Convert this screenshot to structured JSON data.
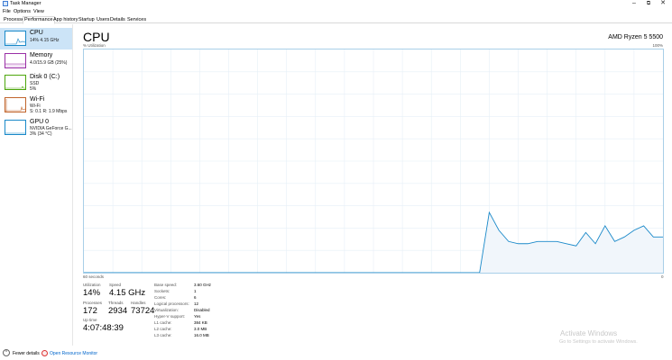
{
  "window": {
    "title": "Task Manager",
    "minimize": "–",
    "maximize": "⧉",
    "close": "✕"
  },
  "menu": [
    "File",
    "Options",
    "View"
  ],
  "tabs": [
    "Processes",
    "Performance",
    "App history",
    "Startup",
    "Users",
    "Details",
    "Services"
  ],
  "active_tab": "Performance",
  "sidebar": {
    "items": [
      {
        "name": "CPU",
        "lines": [
          "14%  4.15 GHz"
        ],
        "color": "#1a89c9",
        "selected": true
      },
      {
        "name": "Memory",
        "lines": [
          "4.0/15.9 GB (25%)"
        ],
        "color": "#9a2fa6",
        "selected": false
      },
      {
        "name": "Disk 0 (C:)",
        "lines": [
          "SSD",
          "5%"
        ],
        "color": "#4da60c",
        "selected": false
      },
      {
        "name": "Wi-Fi",
        "lines": [
          "Wi-Fi",
          "S: 0.1  R: 1.9 Mbps"
        ],
        "color": "#c1642b",
        "selected": false
      },
      {
        "name": "GPU 0",
        "lines": [
          "NVIDIA GeForce G...",
          "3%  (34 °C)"
        ],
        "color": "#1a89c9",
        "selected": false
      }
    ]
  },
  "main": {
    "title": "CPU",
    "model": "AMD Ryzen 5 5500",
    "util_label": "% Utilization",
    "util_max": "100%",
    "axis_left": "60 seconds",
    "axis_right": "0"
  },
  "chart_data": {
    "type": "area",
    "ylim": [
      0,
      100
    ],
    "xlim": [
      60,
      0
    ],
    "grid": true,
    "x": [
      60,
      19,
      18,
      17,
      16,
      15,
      14,
      13,
      12,
      11,
      10,
      9,
      8,
      7,
      6,
      5,
      4,
      3,
      2,
      1,
      0
    ],
    "values": [
      0,
      0,
      27,
      19,
      14,
      13,
      13,
      14,
      14,
      14,
      13,
      12,
      18,
      13,
      21,
      14,
      16,
      19,
      21,
      16,
      16
    ],
    "line_color": "#1a89c9",
    "fill_color": "#f1f6fb"
  },
  "stats": {
    "utilization": {
      "label": "Utilization",
      "value": "14%"
    },
    "speed": {
      "label": "Speed",
      "value": "4.15 GHz"
    },
    "processes": {
      "label": "Processes",
      "value": "172"
    },
    "threads": {
      "label": "Threads",
      "value": "2934"
    },
    "handles": {
      "label": "Handles",
      "value": "73724"
    },
    "uptime": {
      "label": "Up time",
      "value": "4:07:48:39"
    }
  },
  "info": [
    {
      "label": "Base speed:",
      "value": "3.60 GHz"
    },
    {
      "label": "Sockets:",
      "value": "1"
    },
    {
      "label": "Cores:",
      "value": "6"
    },
    {
      "label": "Logical processors:",
      "value": "12"
    },
    {
      "label": "Virtualization:",
      "value": "Disabled"
    },
    {
      "label": "Hyper-V support:",
      "value": "Yes"
    },
    {
      "label": "L1 cache:",
      "value": "384 KB"
    },
    {
      "label": "L2 cache:",
      "value": "3.0 MB"
    },
    {
      "label": "L3 cache:",
      "value": "16.0 MB"
    }
  ],
  "watermark": {
    "title": "Activate Windows",
    "subtitle": "Go to Settings to activate Windows."
  },
  "footer": {
    "fewer_details": "Fewer details",
    "open_resource_monitor": "Open Resource Monitor"
  },
  "icons": {
    "app": "task-manager-icon",
    "fewer": "chevron-up-icon",
    "monitor": "resource-monitor-icon"
  }
}
